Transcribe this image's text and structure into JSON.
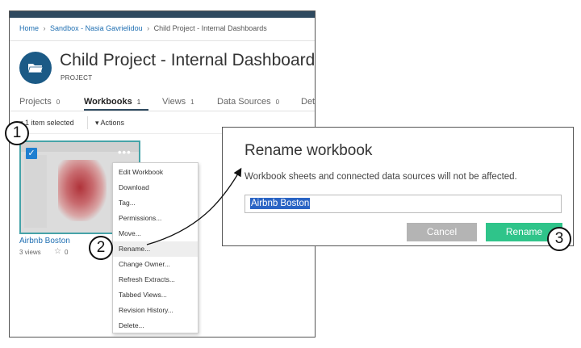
{
  "breadcrumb": {
    "home": "Home",
    "sandbox": "Sandbox - Nasia Gavrielidou",
    "current": "Child Project - Internal Dashboards",
    "separator": "›"
  },
  "project": {
    "title": "Child Project - Internal Dashboards",
    "type": "PROJECT"
  },
  "tabs": [
    {
      "label": "Projects",
      "count": "0"
    },
    {
      "label": "Workbooks",
      "count": "1"
    },
    {
      "label": "Views",
      "count": "1"
    },
    {
      "label": "Data Sources",
      "count": "0"
    },
    {
      "label": "Det",
      "count": ""
    }
  ],
  "active_tab": "Workbooks",
  "selection": {
    "text": "1 item selected",
    "actions": "Actions"
  },
  "workbook": {
    "name": "Airbnb Boston",
    "views": "3 views",
    "favorites": "0"
  },
  "context_menu": {
    "items": [
      "Edit Workbook",
      "Download",
      "Tag...",
      "Permissions...",
      "Move...",
      "Rename...",
      "Change Owner...",
      "Refresh Extracts...",
      "Tabbed Views...",
      "Revision History...",
      "Delete..."
    ],
    "highlighted": "Rename..."
  },
  "dialog": {
    "title": "Rename workbook",
    "message": "Workbook sheets and connected data sources will not be affected.",
    "input_value": "Airbnb Boston",
    "cancel_label": "Cancel",
    "rename_label": "Rename"
  },
  "callouts": [
    "1",
    "2",
    "3"
  ],
  "colors": {
    "brand_dark": "#2f4a60",
    "link": "#1f6fb2",
    "rename_button": "#2fc48a",
    "cancel_button": "#b4b4b4",
    "selection_highlight": "#2a64c4",
    "card_border": "#46a3a8"
  },
  "icons": {
    "project": "folder-icon",
    "checkbox": "checkmark-icon",
    "more": "ellipsis-icon",
    "favorite": "star-icon",
    "dropdown": "caret-down-icon"
  }
}
